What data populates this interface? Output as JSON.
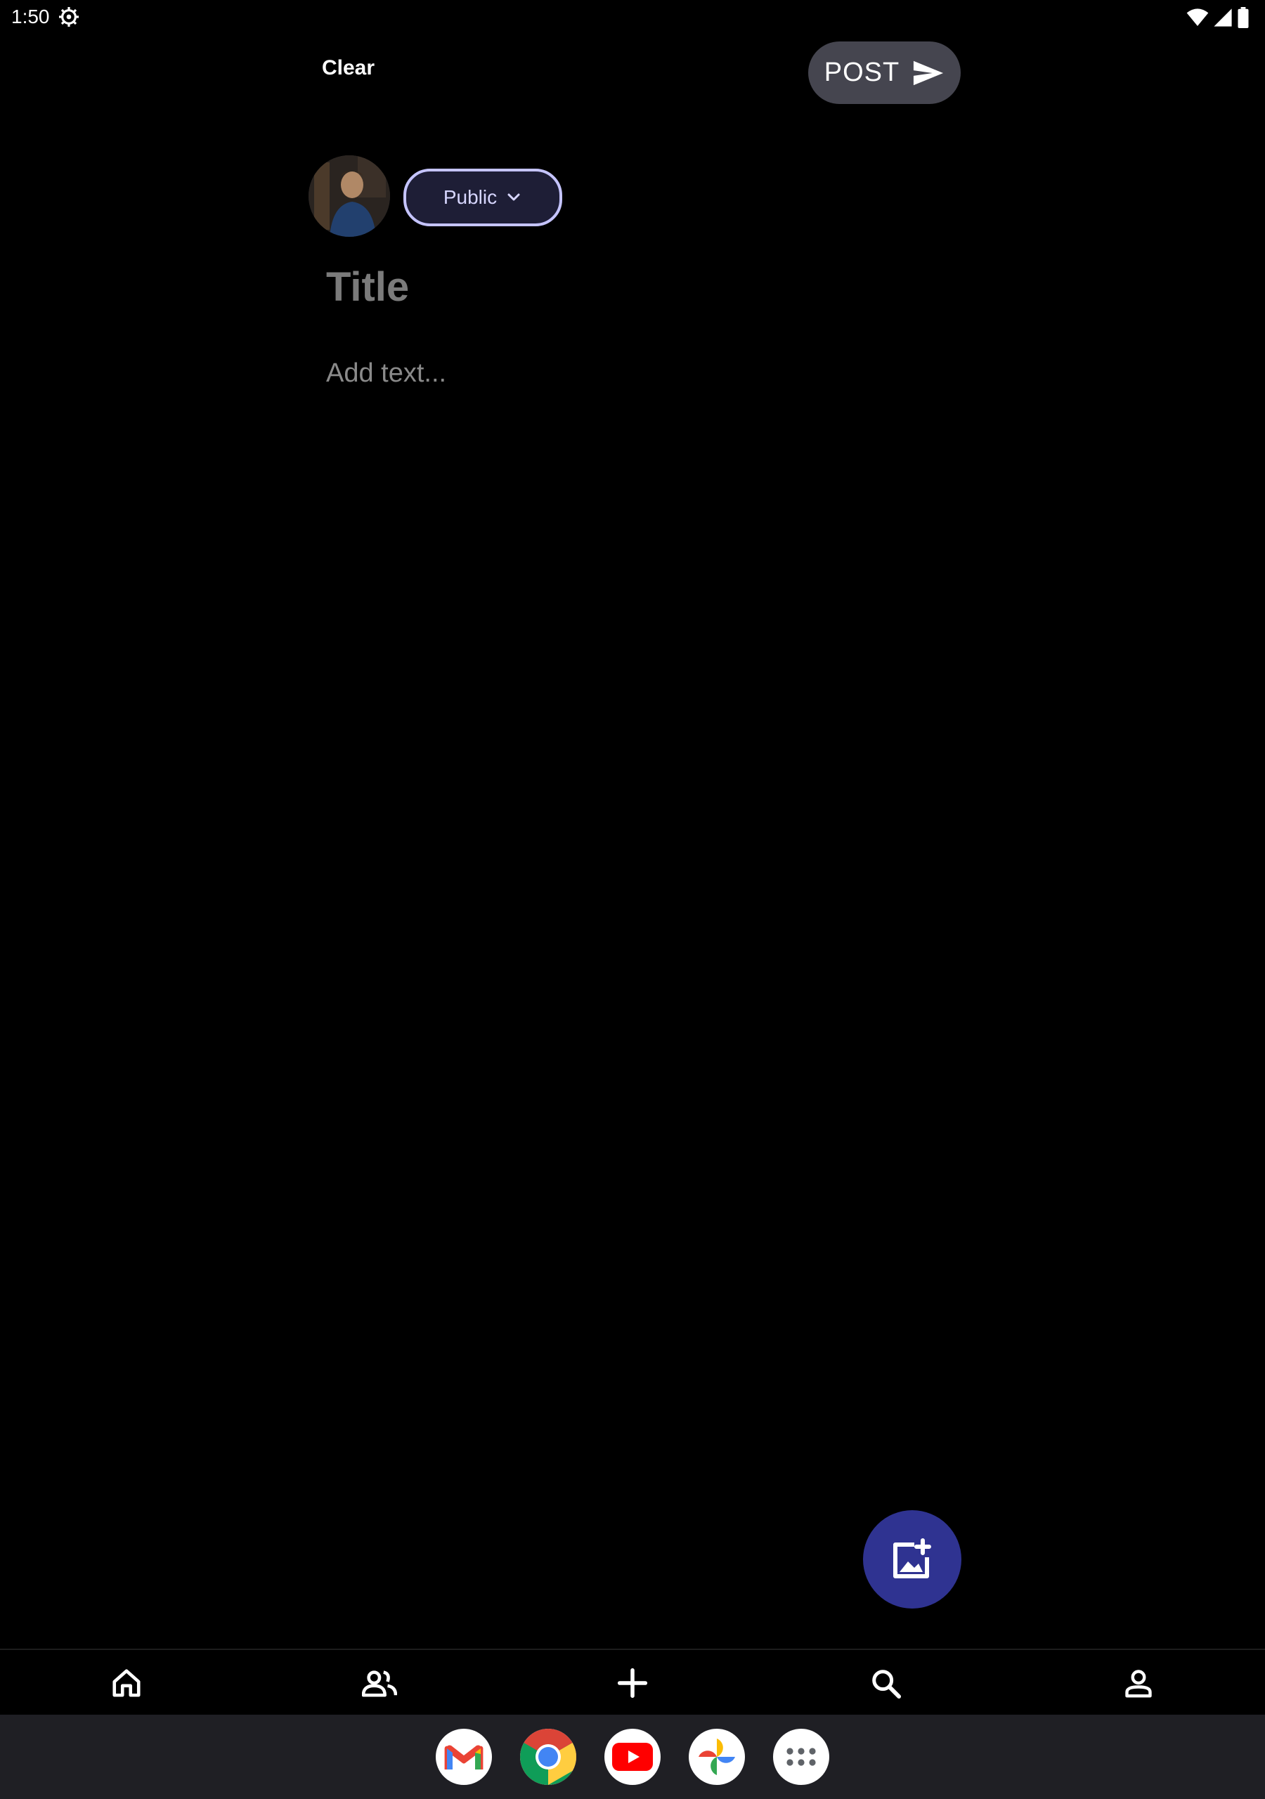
{
  "status_bar": {
    "time": "1:50",
    "icons": [
      "settings-gear-icon",
      "wifi-icon",
      "signal-icon",
      "battery-icon"
    ]
  },
  "toolbar": {
    "clear_label": "Clear",
    "post_label": "POST",
    "post_icon": "send-icon"
  },
  "author": {
    "avatar_icon": "user-avatar",
    "audience_label": "Public",
    "audience_icon": "chevron-down-icon"
  },
  "editor": {
    "title_placeholder": "Title",
    "body_placeholder": "Add text..."
  },
  "fab": {
    "icon": "add-image-icon"
  },
  "bottom_nav": {
    "items": [
      "home-icon",
      "people-icon",
      "add-icon",
      "search-icon",
      "profile-icon"
    ]
  },
  "dock": {
    "apps": [
      "gmail-icon",
      "chrome-icon",
      "youtube-icon",
      "photos-icon",
      "app-drawer-icon"
    ]
  },
  "colors": {
    "background": "#000000",
    "post_button": "#45454f",
    "chip_border": "#c5c4ff",
    "chip_text": "#d7d6ff",
    "fab": "#2f3391",
    "dock": "#1f1f24"
  }
}
